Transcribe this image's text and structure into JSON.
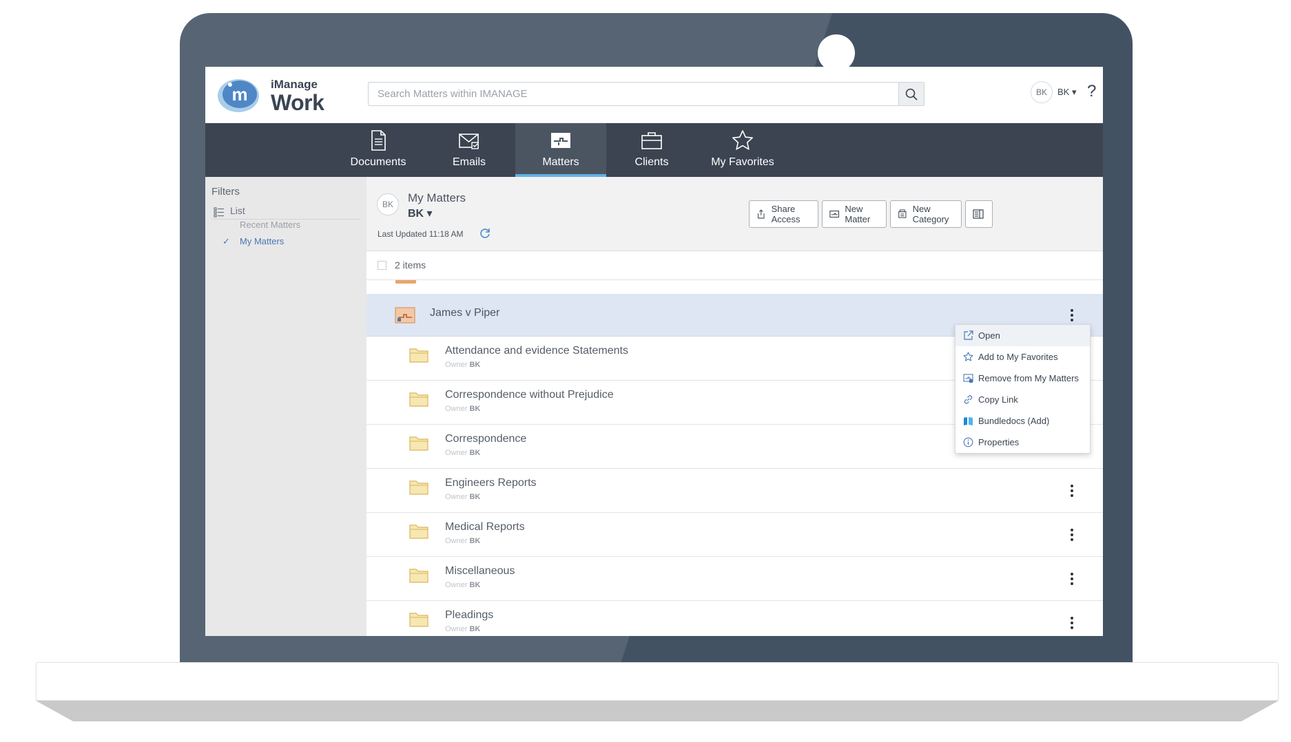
{
  "app": {
    "brand_top": "iManage",
    "brand_bottom": "Work"
  },
  "search": {
    "placeholder": "Search Matters within IMANAGE"
  },
  "user": {
    "initials": "BK",
    "menu_label": "BK ▾"
  },
  "help_label": "?",
  "nav": {
    "items": [
      {
        "label": "Documents",
        "icon": "document-icon"
      },
      {
        "label": "Emails",
        "icon": "email-icon"
      },
      {
        "label": "Matters",
        "icon": "matter-icon",
        "active": true
      },
      {
        "label": "Clients",
        "icon": "briefcase-icon"
      },
      {
        "label": "My Favorites",
        "icon": "star-icon"
      }
    ]
  },
  "sidebar": {
    "title": "Filters",
    "view_label": "List",
    "links": [
      {
        "label": "Recent Matters",
        "selected": false
      },
      {
        "label": "My Matters",
        "selected": true
      }
    ],
    "check": "✓"
  },
  "toolbar": {
    "avatar": "BK",
    "title": "My Matters",
    "owner": "BK ▾",
    "last_updated": "Last Updated 11:18 AM",
    "buttons": [
      {
        "label": "Share Access",
        "icon": "share-icon"
      },
      {
        "label": "New Matter",
        "icon": "new-matter-icon"
      },
      {
        "label": "New Category",
        "icon": "new-category-icon"
      },
      {
        "label": "",
        "icon": "columns-icon"
      }
    ]
  },
  "list": {
    "count": "2 items",
    "matter": {
      "name": "James v Piper"
    },
    "owner_prefix": "Owner",
    "folders": [
      {
        "name": "Attendance and evidence Statements",
        "owner": "BK"
      },
      {
        "name": "Correspondence without Prejudice",
        "owner": "BK"
      },
      {
        "name": "Correspondence",
        "owner": "BK"
      },
      {
        "name": "Engineers Reports",
        "owner": "BK"
      },
      {
        "name": "Medical Reports",
        "owner": "BK"
      },
      {
        "name": "Miscellaneous",
        "owner": "BK"
      },
      {
        "name": "Pleadings",
        "owner": "BK"
      }
    ]
  },
  "context_menu": {
    "items": [
      {
        "label": "Open",
        "icon": "open-external-icon"
      },
      {
        "label": "Add to My Favorites",
        "icon": "star-outline-icon"
      },
      {
        "label": "Remove from My Matters",
        "icon": "remove-matter-icon"
      },
      {
        "label": "Copy Link",
        "icon": "link-icon"
      },
      {
        "label": "Bundledocs (Add)",
        "icon": "bundledocs-icon"
      },
      {
        "label": "Properties",
        "icon": "info-icon"
      }
    ]
  },
  "colors": {
    "nav_bg": "#3b4450",
    "active_underline": "#61b2e6",
    "selected_row": "#dfe6f3",
    "link_blue": "#4a77b4",
    "laptop_body": "#435263",
    "folder": "#f3e3a8"
  }
}
